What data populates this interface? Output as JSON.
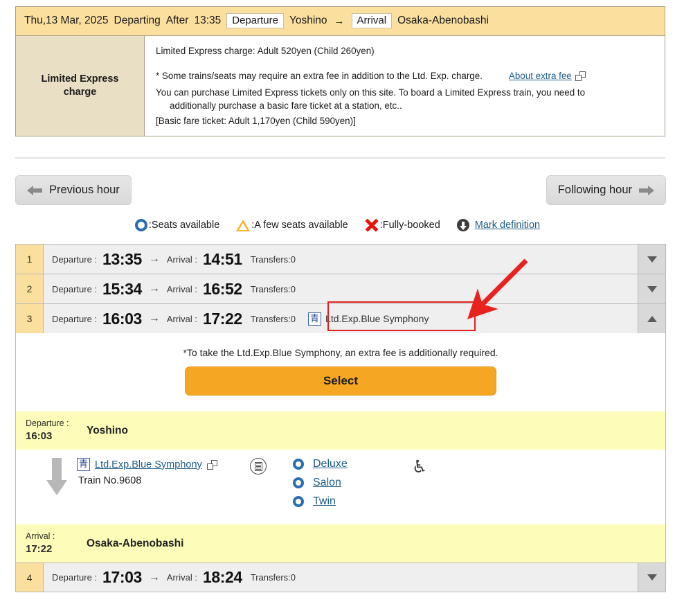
{
  "search_summary": {
    "date": "Thu,13 Mar, 2025",
    "departing_label": "Departing",
    "after_label": "After",
    "after_time": "13:35",
    "departure_label": "Departure",
    "departure_station": "Yoshino",
    "arrow": "→",
    "arrival_label": "Arrival",
    "arrival_station": "Osaka-Abenobashi"
  },
  "fee_section": {
    "row_label": "Limited Express\ncharge",
    "charge_line": "Limited Express charge: Adult 520yen (Child 260yen)",
    "note_star": "* Some trains/seats may require an extra fee in addition to the Ltd. Exp. charge.",
    "about_extra_fee_link": "About extra fee",
    "popup_icon": "popup-window-icon",
    "purchase_note_1": "You can purchase Limited Express tickets only on this site. To board a Limited Express train, you need to",
    "purchase_note_2": "additionally purchase a basic fare ticket at a station, etc..",
    "basic_fare_line": "[Basic fare ticket: Adult 1,170yen (Child 590yen)]"
  },
  "hour_nav": {
    "previous_label": "Previous hour",
    "following_label": "Following hour",
    "previous_icon": "arrow-left-icon",
    "following_icon": "arrow-right-icon"
  },
  "legend": {
    "seats_available": ":Seats available",
    "few_seats": ":A few seats available",
    "fully_booked": ":Fully-booked",
    "mark_definition": "Mark definition",
    "icons": {
      "available": "circle-ring-icon",
      "few": "triangle-icon",
      "full": "x-mark-icon",
      "download": "download-circle-icon"
    },
    "colors": {
      "available": "#2a6eb0",
      "few": "#f8b227",
      "full": "#e8140c"
    }
  },
  "results": {
    "labels": {
      "departure": "Departure :",
      "arrival": "Arrival :",
      "transfers_prefix": "Transfers:"
    },
    "rows": [
      {
        "index": "1",
        "departure_time": "13:35",
        "arrow": "→",
        "arrival_time": "14:51",
        "transfers": "0",
        "train_name": "",
        "expanded": false,
        "toggle_icon": "chevron-down-icon"
      },
      {
        "index": "2",
        "departure_time": "15:34",
        "arrow": "→",
        "arrival_time": "16:52",
        "transfers": "0",
        "train_name": "",
        "expanded": false,
        "toggle_icon": "chevron-down-icon"
      },
      {
        "index": "3",
        "departure_time": "16:03",
        "arrow": "→",
        "arrival_time": "17:22",
        "transfers": "0",
        "train_name": "Ltd.Exp.Blue Symphony",
        "train_badge": "青",
        "expanded": true,
        "toggle_icon": "chevron-up-icon"
      },
      {
        "index": "4",
        "departure_time": "17:03",
        "arrow": "→",
        "arrival_time": "18:24",
        "transfers": "0",
        "train_name": "",
        "expanded": false,
        "toggle_icon": "chevron-down-icon"
      }
    ]
  },
  "detail": {
    "extra_fee_note": "*To take the Ltd.Exp.Blue Symphony, an extra fee is additionally required.",
    "select_button": "Select",
    "departure": {
      "label": "Departure :",
      "time": "16:03",
      "station": "Yoshino"
    },
    "arrival": {
      "label": "Arrival :",
      "time": "17:22",
      "station": "Osaka-Abenobashi"
    },
    "leg": {
      "train_badge": "青",
      "train_link": "Ltd.Exp.Blue Symphony",
      "popup_icon": "popup-window-icon",
      "train_number": "Train No.9608",
      "vending_icon": "vending-machine-icon",
      "wheelchair_icon": "wheelchair-accessible-icon",
      "seat_classes": [
        {
          "name": "Deluxe",
          "availability_icon": "circle-ring-icon"
        },
        {
          "name": "Salon",
          "availability_icon": "circle-ring-icon"
        },
        {
          "name": "Twin",
          "availability_icon": "circle-ring-icon"
        }
      ]
    }
  },
  "annotation": {
    "highlight_color": "#e02020",
    "arrow_icon": "red-pointer-arrow"
  }
}
